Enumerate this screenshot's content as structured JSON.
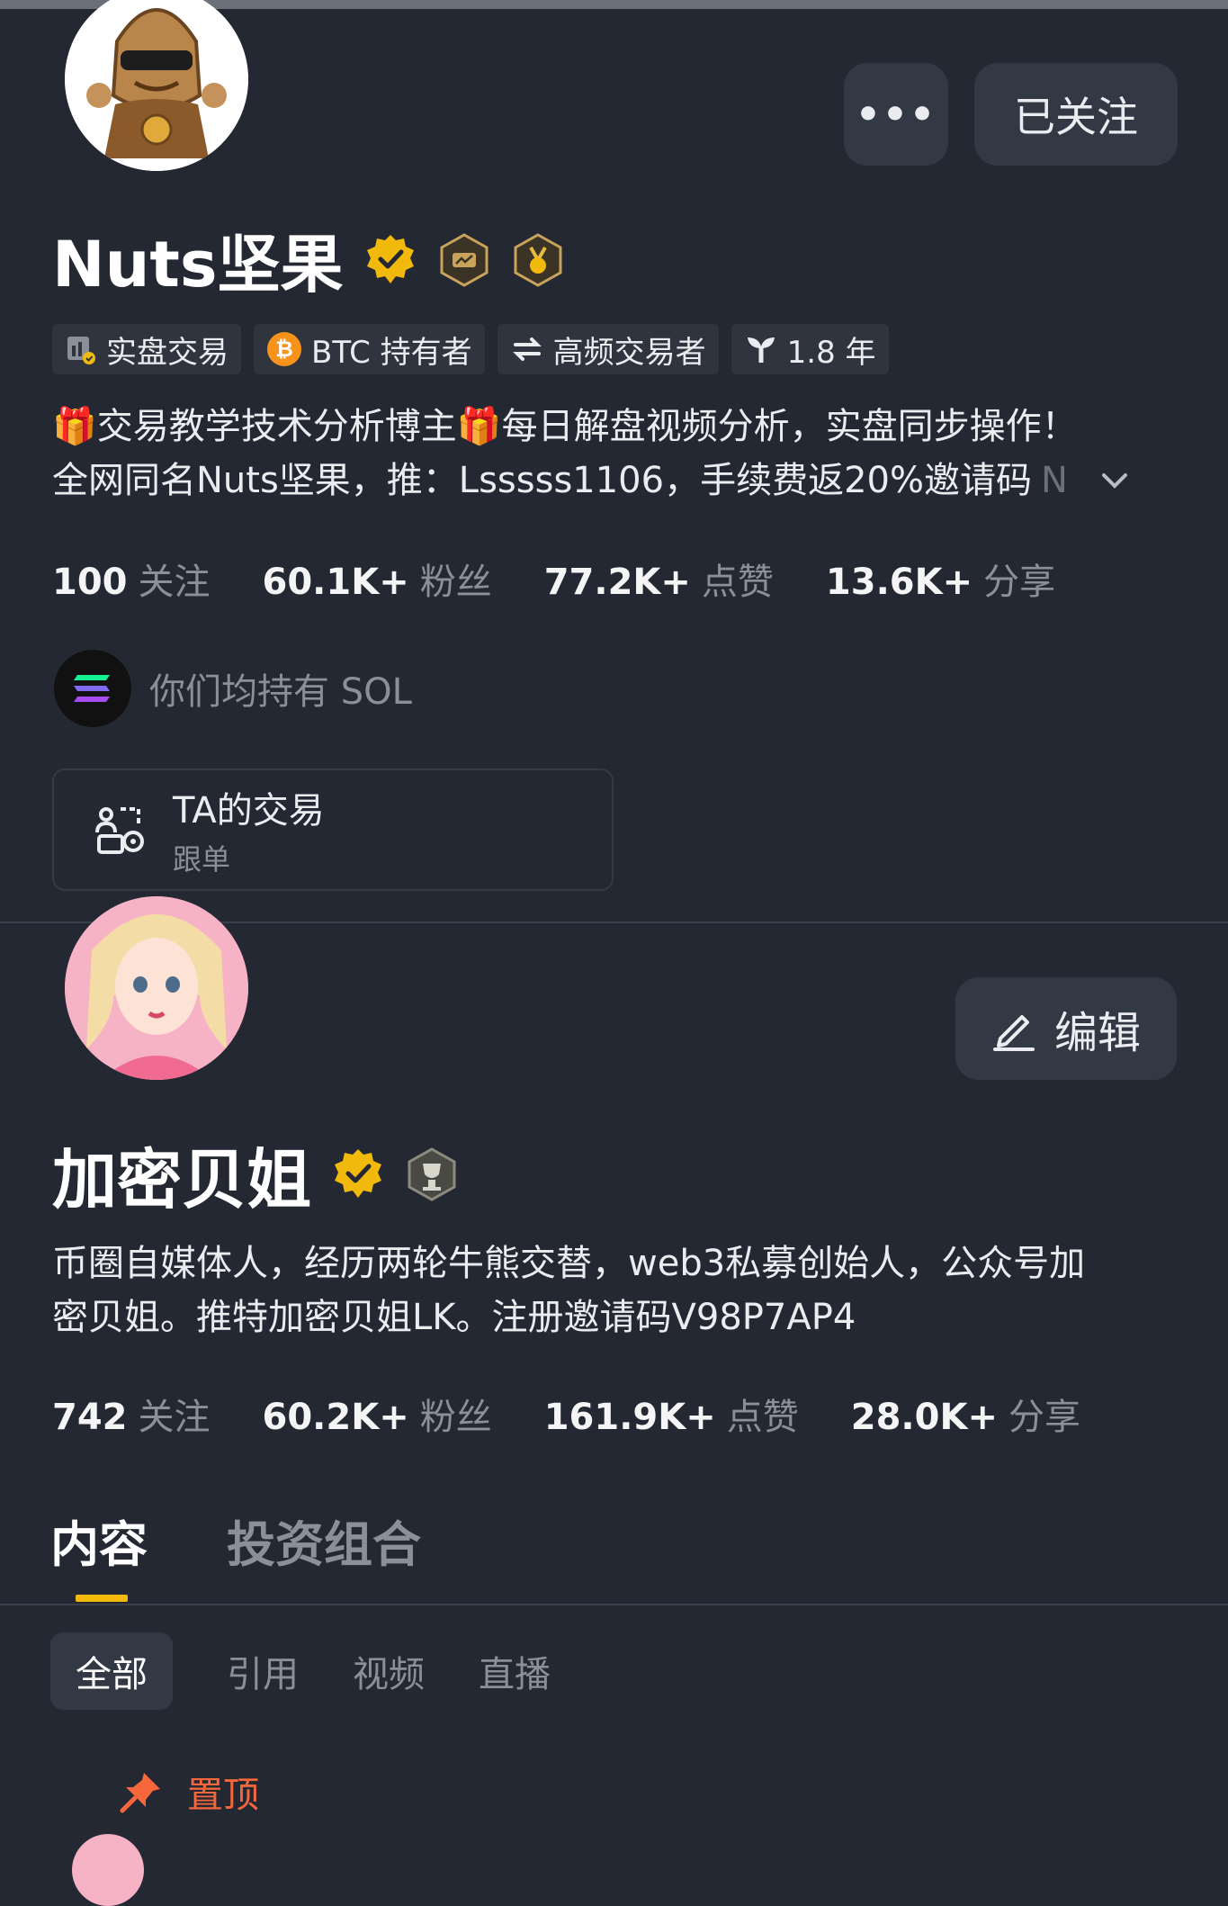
{
  "profile1": {
    "more_icon": "more-dots-icon",
    "follow_label": "已关注",
    "name": "Nuts坚果",
    "tags": [
      {
        "icon": "chart-verify-icon",
        "label": "实盘交易"
      },
      {
        "icon": "bitcoin-icon",
        "label": "BTC 持有者"
      },
      {
        "icon": "exchange-arrows-icon",
        "label": "高频交易者"
      },
      {
        "icon": "sprout-icon",
        "label": "1.8 年"
      }
    ],
    "bio_line1": "🎁交易教学技术分析博主🎁每日解盘视频分析，实盘同步操作！",
    "bio_line2": "全网同名Nuts坚果，推：Lsssss1106，手续费返20%邀请码",
    "bio_fade": "N",
    "stats": [
      {
        "num": "100",
        "label": "关注"
      },
      {
        "num": "60.1K+",
        "label": "粉丝"
      },
      {
        "num": "77.2K+",
        "label": "点赞"
      },
      {
        "num": "13.6K+",
        "label": "分享"
      }
    ],
    "common_hold": "你们均持有 SOL",
    "trade_card": {
      "title": "TA的交易",
      "subtitle": "跟单"
    }
  },
  "profile2": {
    "edit_label": "编辑",
    "name": "加密贝姐",
    "bio_line1": "币圈自媒体人，经历两轮牛熊交替，web3私募创始人，公众号加",
    "bio_line2": "密贝姐。推特加密贝姐LK。注册邀请码V98P7AP4",
    "stats": [
      {
        "num": "742",
        "label": "关注"
      },
      {
        "num": "60.2K+",
        "label": "粉丝"
      },
      {
        "num": "161.9K+",
        "label": "点赞"
      },
      {
        "num": "28.0K+",
        "label": "分享"
      }
    ],
    "tabs": [
      "内容",
      "投资组合"
    ],
    "subtabs": [
      "全部",
      "引用",
      "视频",
      "直播"
    ],
    "pinned_label": "置顶"
  },
  "colors": {
    "background": "#242833",
    "accent_yellow": "#f0b90b",
    "pinned_orange": "#f6673b",
    "muted_text": "#8a8f99"
  }
}
